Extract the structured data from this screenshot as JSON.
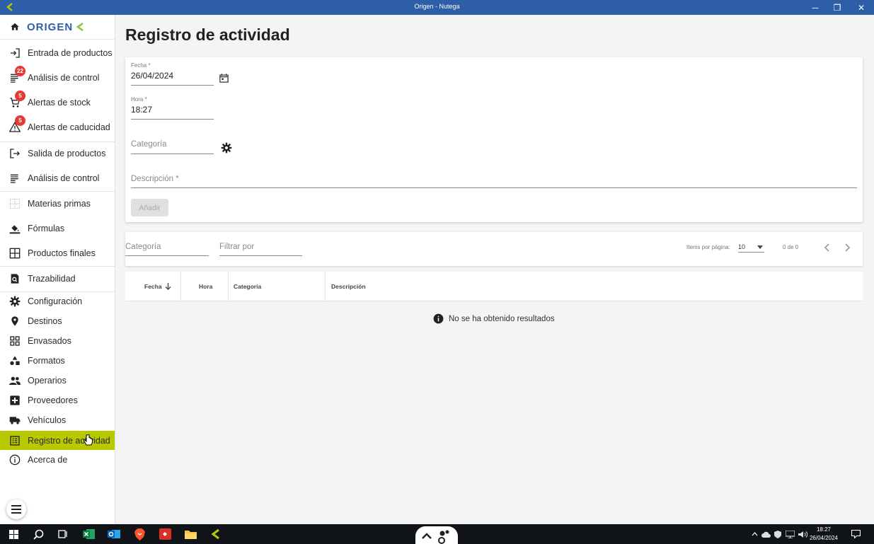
{
  "window": {
    "title": "Origen - Nutega",
    "controls": {
      "minimize": "─",
      "restore": "❐",
      "close": "✕"
    }
  },
  "brand": {
    "name": "ORIGEN",
    "accent": "#b8c900",
    "primary": "#2f5ea8"
  },
  "sidebar": {
    "items": [
      {
        "label": "Entrada de productos",
        "icon": "login-icon"
      },
      {
        "label": "Análisis de control",
        "icon": "list-icon",
        "badge": "22"
      },
      {
        "label": "Alertas de stock",
        "icon": "cart-icon",
        "badge": "5"
      },
      {
        "label": "Alertas de caducidad",
        "icon": "warning-icon",
        "badge": "5"
      },
      {
        "label": "Salida de productos",
        "icon": "logout-icon"
      },
      {
        "label": "Análisis de control",
        "icon": "list-icon"
      },
      {
        "label": "Materias primas",
        "icon": "grid-dots-icon"
      },
      {
        "label": "Fórmulas",
        "icon": "paint-bucket-icon"
      },
      {
        "label": "Productos finales",
        "icon": "grid-icon"
      },
      {
        "label": "Trazabilidad",
        "icon": "document-search-icon"
      },
      {
        "label": "Configuración",
        "icon": "gear-icon"
      },
      {
        "label": "Destinos",
        "icon": "location-pin-icon"
      },
      {
        "label": "Envasados",
        "icon": "apps-icon"
      },
      {
        "label": "Formatos",
        "icon": "shapes-icon"
      },
      {
        "label": "Operarios",
        "icon": "people-icon"
      },
      {
        "label": "Proveedores",
        "icon": "add-box-icon"
      },
      {
        "label": "Vehículos",
        "icon": "truck-icon"
      },
      {
        "label": "Registro de actividad",
        "icon": "table-list-icon",
        "active": true
      },
      {
        "label": "Acerca de",
        "icon": "info-icon"
      }
    ]
  },
  "main": {
    "title": "Registro de actividad",
    "form": {
      "fecha": {
        "label": "Fecha *",
        "value": "26/04/2024"
      },
      "hora": {
        "label": "Hora *",
        "value": "18:27"
      },
      "categoria": {
        "placeholder": "Categoría"
      },
      "descripcion": {
        "placeholder": "Descripción *"
      },
      "add_label": "Añadir"
    },
    "filters": {
      "categoria_placeholder": "Categoría",
      "filtrar_placeholder": "Filtrar por",
      "items_per_page_label": "Items por página:",
      "items_per_page_value": "10",
      "range_label": "0 de 0"
    },
    "table": {
      "columns": [
        "Fecha",
        "Hora",
        "Categoría",
        "Descripción"
      ],
      "empty_message": "No se ha obtenido resultados"
    }
  },
  "taskbar": {
    "time": "18:27",
    "date": "26/04/2024"
  }
}
